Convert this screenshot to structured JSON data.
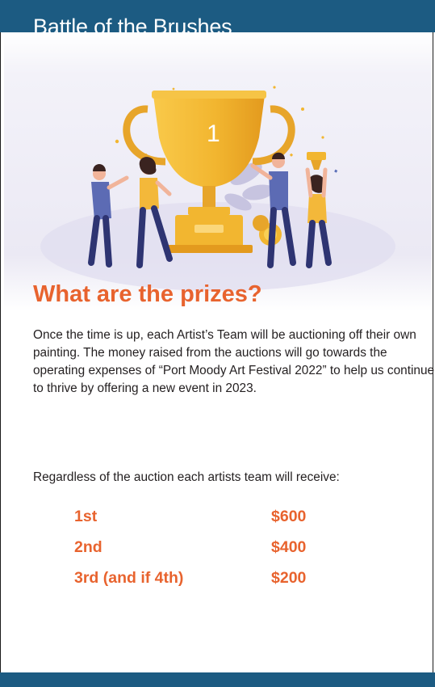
{
  "header": {
    "title": "Battle of the Brushes"
  },
  "hero": {
    "illustration": "trophy-celebration-illustration",
    "trophy_number": "1"
  },
  "content": {
    "heading": "What are the prizes?",
    "paragraph": "Once the time is up, each Artist’s Team will be auctioning off their own painting. The money raised from the auctions will go towards the operating expenses of “Port Moody Art Festival 2022” to help us continue to thrive by offering a new event in 2023.",
    "auction_note": "Regardless of the auction each artists team will receive:"
  },
  "prizes": [
    {
      "place": "1st",
      "amount": "$600"
    },
    {
      "place": "2nd",
      "amount": "$400"
    },
    {
      "place": "3rd (and if 4th)",
      "amount": "$200"
    }
  ],
  "colors": {
    "brand_blue": "#1c5b82",
    "accent_orange": "#e8632e",
    "trophy_gold": "#f2b630"
  }
}
